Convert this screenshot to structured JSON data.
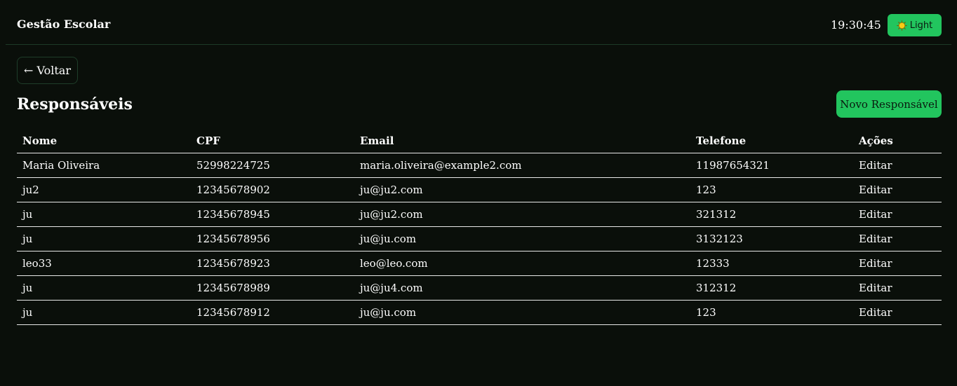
{
  "header": {
    "title": "Gestão Escolar",
    "clock": "19:30:45",
    "theme_toggle": {
      "label": "Light",
      "icon": "sun-icon"
    }
  },
  "nav": {
    "back_label": "← Voltar"
  },
  "page": {
    "title": "Responsáveis",
    "new_button_label": "Novo Responsável"
  },
  "table": {
    "columns": [
      "Nome",
      "CPF",
      "Email",
      "Telefone",
      "Ações"
    ],
    "rows": [
      {
        "nome": "Maria Oliveira",
        "cpf": "52998224725",
        "email": "maria.oliveira@example2.com",
        "telefone": "11987654321",
        "acao": "Editar"
      },
      {
        "nome": "ju2",
        "cpf": "12345678902",
        "email": "ju@ju2.com",
        "telefone": "123",
        "acao": "Editar"
      },
      {
        "nome": "ju",
        "cpf": "12345678945",
        "email": "ju@ju2.com",
        "telefone": "321312",
        "acao": "Editar"
      },
      {
        "nome": "ju",
        "cpf": "12345678956",
        "email": "ju@ju.com",
        "telefone": "3132123",
        "acao": "Editar"
      },
      {
        "nome": "leo33",
        "cpf": "12345678923",
        "email": "leo@leo.com",
        "telefone": "12333",
        "acao": "Editar"
      },
      {
        "nome": "ju",
        "cpf": "12345678989",
        "email": "ju@ju4.com",
        "telefone": "312312",
        "acao": "Editar"
      },
      {
        "nome": "ju",
        "cpf": "12345678912",
        "email": "ju@ju.com",
        "telefone": "123",
        "acao": "Editar"
      }
    ]
  },
  "colors": {
    "background": "#0a0f0a",
    "accent": "#22c55e",
    "border": "#1c3a26",
    "text": "#ffffff"
  }
}
